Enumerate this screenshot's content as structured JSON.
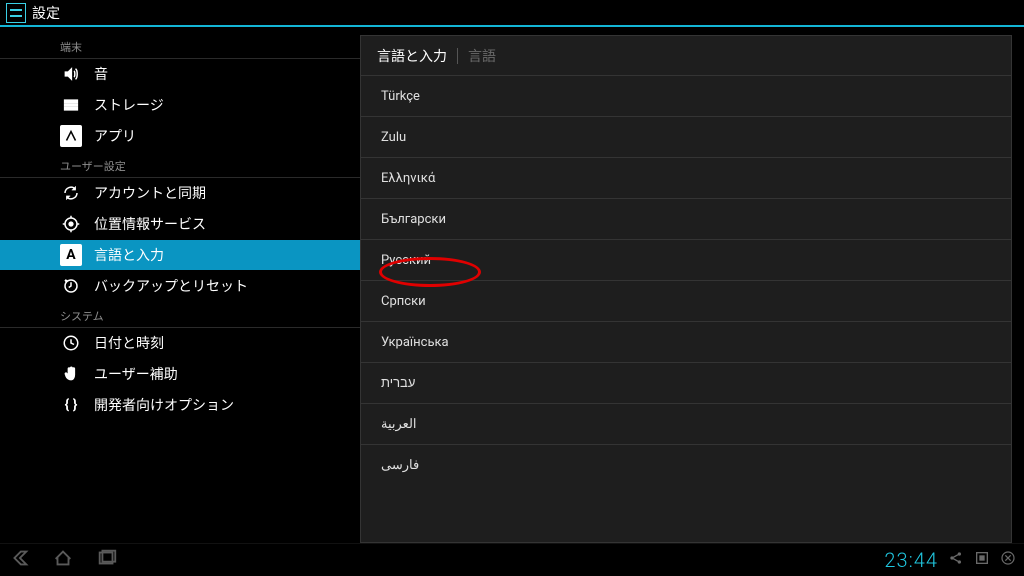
{
  "statusbar": {
    "title": "設定"
  },
  "sidebar": {
    "categories": [
      {
        "label": "端末",
        "items": [
          {
            "id": "sound",
            "icon": "volume",
            "label": "音"
          },
          {
            "id": "storage",
            "icon": "storage",
            "label": "ストレージ"
          },
          {
            "id": "apps",
            "icon": "apps",
            "label": "アプリ"
          }
        ]
      },
      {
        "label": "ユーザー設定",
        "items": [
          {
            "id": "accounts",
            "icon": "sync",
            "label": "アカウントと同期"
          },
          {
            "id": "location",
            "icon": "location",
            "label": "位置情報サービス"
          },
          {
            "id": "language",
            "icon": "lang",
            "label": "言語と入力",
            "selected": true
          },
          {
            "id": "backup",
            "icon": "backup",
            "label": "バックアップとリセット"
          }
        ]
      },
      {
        "label": "システム",
        "items": [
          {
            "id": "datetime",
            "icon": "clock",
            "label": "日付と時刻"
          },
          {
            "id": "a11y",
            "icon": "hand",
            "label": "ユーザー補助"
          },
          {
            "id": "dev",
            "icon": "braces",
            "label": "開発者向けオプション"
          }
        ]
      }
    ]
  },
  "main": {
    "breadcrumb": {
      "current": "言語と入力",
      "sub": "言語"
    },
    "languages": [
      "Türkçe",
      "Zulu",
      "Ελληνικά",
      "Български",
      "Русский",
      "Српски",
      "Українська",
      "עברית",
      "العربية",
      "فارسی"
    ],
    "highlighted_index": 4
  },
  "navbar": {
    "clock": "23:44"
  },
  "colors": {
    "accent": "#13b5d6",
    "highlight_ring": "#e00000"
  }
}
